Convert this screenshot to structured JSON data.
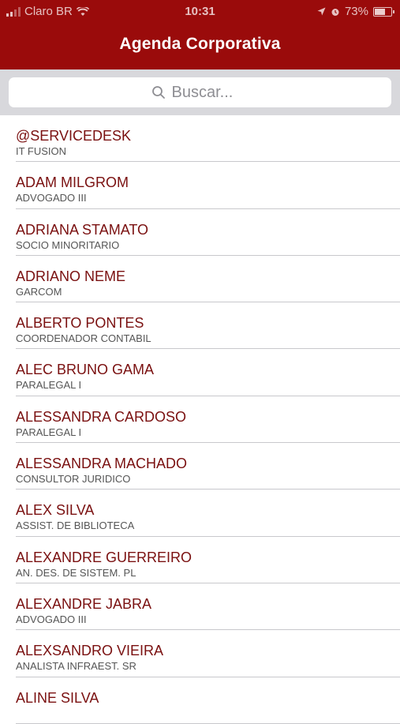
{
  "status_bar": {
    "carrier": "Claro BR",
    "time": "10:31",
    "battery": "73%",
    "battery_level": 0.73
  },
  "nav": {
    "title": "Agenda Corporativa"
  },
  "search": {
    "placeholder": "Buscar..."
  },
  "contacts": [
    {
      "name": "@SERVICEDESK",
      "role": "IT FUSION"
    },
    {
      "name": "ADAM MILGROM",
      "role": "ADVOGADO III"
    },
    {
      "name": "ADRIANA STAMATO",
      "role": "SOCIO MINORITARIO"
    },
    {
      "name": "ADRIANO NEME",
      "role": "GARCOM"
    },
    {
      "name": "ALBERTO PONTES",
      "role": "COORDENADOR CONTABIL"
    },
    {
      "name": "ALEC BRUNO GAMA",
      "role": "PARALEGAL I"
    },
    {
      "name": "ALESSANDRA CARDOSO",
      "role": "PARALEGAL I"
    },
    {
      "name": "ALESSANDRA MACHADO",
      "role": "CONSULTOR JURIDICO"
    },
    {
      "name": "ALEX SILVA",
      "role": "ASSIST. DE BIBLIOTECA"
    },
    {
      "name": "ALEXANDRE GUERREIRO",
      "role": "AN. DES. DE SISTEM. PL"
    },
    {
      "name": "ALEXANDRE JABRA",
      "role": "ADVOGADO III"
    },
    {
      "name": "ALEXSANDRO VIEIRA",
      "role": "ANALISTA INFRAEST. SR"
    },
    {
      "name": "ALINE SILVA",
      "role": ""
    }
  ],
  "colors": {
    "header_bg": "#9a0b0b",
    "name_text": "#7a1010",
    "search_bg": "#d8d8dc"
  }
}
